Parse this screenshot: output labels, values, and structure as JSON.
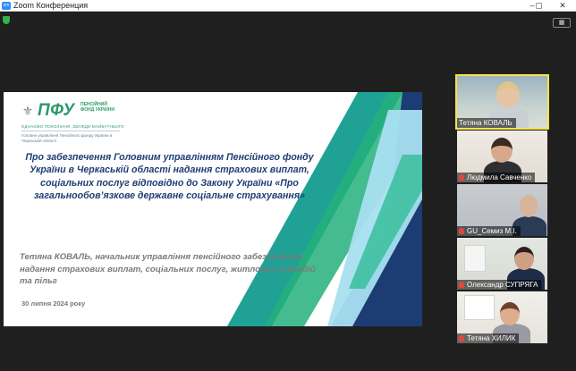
{
  "window": {
    "title": "Zoom Конференция",
    "app_icon": "zm",
    "controls": {
      "minimize": "–",
      "close": "✕"
    }
  },
  "meeting": {
    "view_toggle_icon": "grid-icon",
    "shield_icon": "encryption-shield-icon"
  },
  "slide": {
    "logo": {
      "name": "ПФУ",
      "subtitle": "ПЕНСІЙНИЙ ФОНД УКРАЇНИ",
      "tagline": "ЄДНАЄМО ПОКОЛІННЯ, ЗВАЖДИ МАЙБУТНЬОГО",
      "department": "Головне управління Пенсійного фонду України в Черкаській області"
    },
    "title": "Про забезпечення Головним управлінням Пенсійного фонду України в Черкаській області надання страхових виплат, соціальних послуг відповідно до Закону України «Про загальнообов’язкове державне соціальне страхування»",
    "author": "Тетяна КОВАЛЬ, начальник управління пенсійного забезпечення, надання страхових виплат, соціальних послуг, житлових субсидій та пільг",
    "date": "30 липня 2024 року",
    "colors": {
      "title": "#1f3d73",
      "brand_green": "#2b9a6b",
      "navy": "#1c3d73",
      "teal": "#1fa295"
    }
  },
  "participants": [
    {
      "name": "Тетяна КОВАЛЬ",
      "muted": false,
      "active_speaker": true
    },
    {
      "name": "Людмила Савченко",
      "muted": true,
      "active_speaker": false
    },
    {
      "name": "GU_Семиз М.І.",
      "muted": true,
      "active_speaker": false
    },
    {
      "name": "Олександр СУПРЯГА",
      "muted": true,
      "active_speaker": false
    },
    {
      "name": "Тетяна ХИЛИК",
      "muted": true,
      "active_speaker": false
    }
  ]
}
